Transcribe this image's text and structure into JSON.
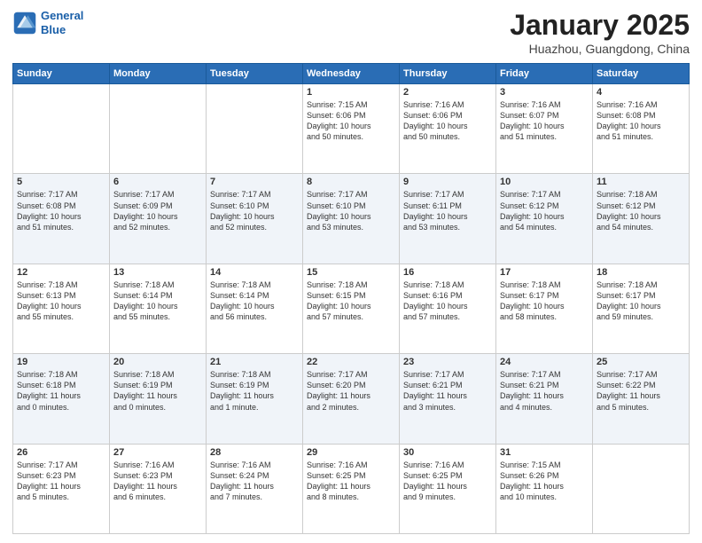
{
  "header": {
    "logo_line1": "General",
    "logo_line2": "Blue",
    "month": "January 2025",
    "location": "Huazhou, Guangdong, China"
  },
  "weekdays": [
    "Sunday",
    "Monday",
    "Tuesday",
    "Wednesday",
    "Thursday",
    "Friday",
    "Saturday"
  ],
  "weeks": [
    [
      {
        "day": "",
        "info": ""
      },
      {
        "day": "",
        "info": ""
      },
      {
        "day": "",
        "info": ""
      },
      {
        "day": "1",
        "info": "Sunrise: 7:15 AM\nSunset: 6:06 PM\nDaylight: 10 hours\nand 50 minutes."
      },
      {
        "day": "2",
        "info": "Sunrise: 7:16 AM\nSunset: 6:06 PM\nDaylight: 10 hours\nand 50 minutes."
      },
      {
        "day": "3",
        "info": "Sunrise: 7:16 AM\nSunset: 6:07 PM\nDaylight: 10 hours\nand 51 minutes."
      },
      {
        "day": "4",
        "info": "Sunrise: 7:16 AM\nSunset: 6:08 PM\nDaylight: 10 hours\nand 51 minutes."
      }
    ],
    [
      {
        "day": "5",
        "info": "Sunrise: 7:17 AM\nSunset: 6:08 PM\nDaylight: 10 hours\nand 51 minutes."
      },
      {
        "day": "6",
        "info": "Sunrise: 7:17 AM\nSunset: 6:09 PM\nDaylight: 10 hours\nand 52 minutes."
      },
      {
        "day": "7",
        "info": "Sunrise: 7:17 AM\nSunset: 6:10 PM\nDaylight: 10 hours\nand 52 minutes."
      },
      {
        "day": "8",
        "info": "Sunrise: 7:17 AM\nSunset: 6:10 PM\nDaylight: 10 hours\nand 53 minutes."
      },
      {
        "day": "9",
        "info": "Sunrise: 7:17 AM\nSunset: 6:11 PM\nDaylight: 10 hours\nand 53 minutes."
      },
      {
        "day": "10",
        "info": "Sunrise: 7:17 AM\nSunset: 6:12 PM\nDaylight: 10 hours\nand 54 minutes."
      },
      {
        "day": "11",
        "info": "Sunrise: 7:18 AM\nSunset: 6:12 PM\nDaylight: 10 hours\nand 54 minutes."
      }
    ],
    [
      {
        "day": "12",
        "info": "Sunrise: 7:18 AM\nSunset: 6:13 PM\nDaylight: 10 hours\nand 55 minutes."
      },
      {
        "day": "13",
        "info": "Sunrise: 7:18 AM\nSunset: 6:14 PM\nDaylight: 10 hours\nand 55 minutes."
      },
      {
        "day": "14",
        "info": "Sunrise: 7:18 AM\nSunset: 6:14 PM\nDaylight: 10 hours\nand 56 minutes."
      },
      {
        "day": "15",
        "info": "Sunrise: 7:18 AM\nSunset: 6:15 PM\nDaylight: 10 hours\nand 57 minutes."
      },
      {
        "day": "16",
        "info": "Sunrise: 7:18 AM\nSunset: 6:16 PM\nDaylight: 10 hours\nand 57 minutes."
      },
      {
        "day": "17",
        "info": "Sunrise: 7:18 AM\nSunset: 6:17 PM\nDaylight: 10 hours\nand 58 minutes."
      },
      {
        "day": "18",
        "info": "Sunrise: 7:18 AM\nSunset: 6:17 PM\nDaylight: 10 hours\nand 59 minutes."
      }
    ],
    [
      {
        "day": "19",
        "info": "Sunrise: 7:18 AM\nSunset: 6:18 PM\nDaylight: 11 hours\nand 0 minutes."
      },
      {
        "day": "20",
        "info": "Sunrise: 7:18 AM\nSunset: 6:19 PM\nDaylight: 11 hours\nand 0 minutes."
      },
      {
        "day": "21",
        "info": "Sunrise: 7:18 AM\nSunset: 6:19 PM\nDaylight: 11 hours\nand 1 minute."
      },
      {
        "day": "22",
        "info": "Sunrise: 7:17 AM\nSunset: 6:20 PM\nDaylight: 11 hours\nand 2 minutes."
      },
      {
        "day": "23",
        "info": "Sunrise: 7:17 AM\nSunset: 6:21 PM\nDaylight: 11 hours\nand 3 minutes."
      },
      {
        "day": "24",
        "info": "Sunrise: 7:17 AM\nSunset: 6:21 PM\nDaylight: 11 hours\nand 4 minutes."
      },
      {
        "day": "25",
        "info": "Sunrise: 7:17 AM\nSunset: 6:22 PM\nDaylight: 11 hours\nand 5 minutes."
      }
    ],
    [
      {
        "day": "26",
        "info": "Sunrise: 7:17 AM\nSunset: 6:23 PM\nDaylight: 11 hours\nand 5 minutes."
      },
      {
        "day": "27",
        "info": "Sunrise: 7:16 AM\nSunset: 6:23 PM\nDaylight: 11 hours\nand 6 minutes."
      },
      {
        "day": "28",
        "info": "Sunrise: 7:16 AM\nSunset: 6:24 PM\nDaylight: 11 hours\nand 7 minutes."
      },
      {
        "day": "29",
        "info": "Sunrise: 7:16 AM\nSunset: 6:25 PM\nDaylight: 11 hours\nand 8 minutes."
      },
      {
        "day": "30",
        "info": "Sunrise: 7:16 AM\nSunset: 6:25 PM\nDaylight: 11 hours\nand 9 minutes."
      },
      {
        "day": "31",
        "info": "Sunrise: 7:15 AM\nSunset: 6:26 PM\nDaylight: 11 hours\nand 10 minutes."
      },
      {
        "day": "",
        "info": ""
      }
    ]
  ]
}
